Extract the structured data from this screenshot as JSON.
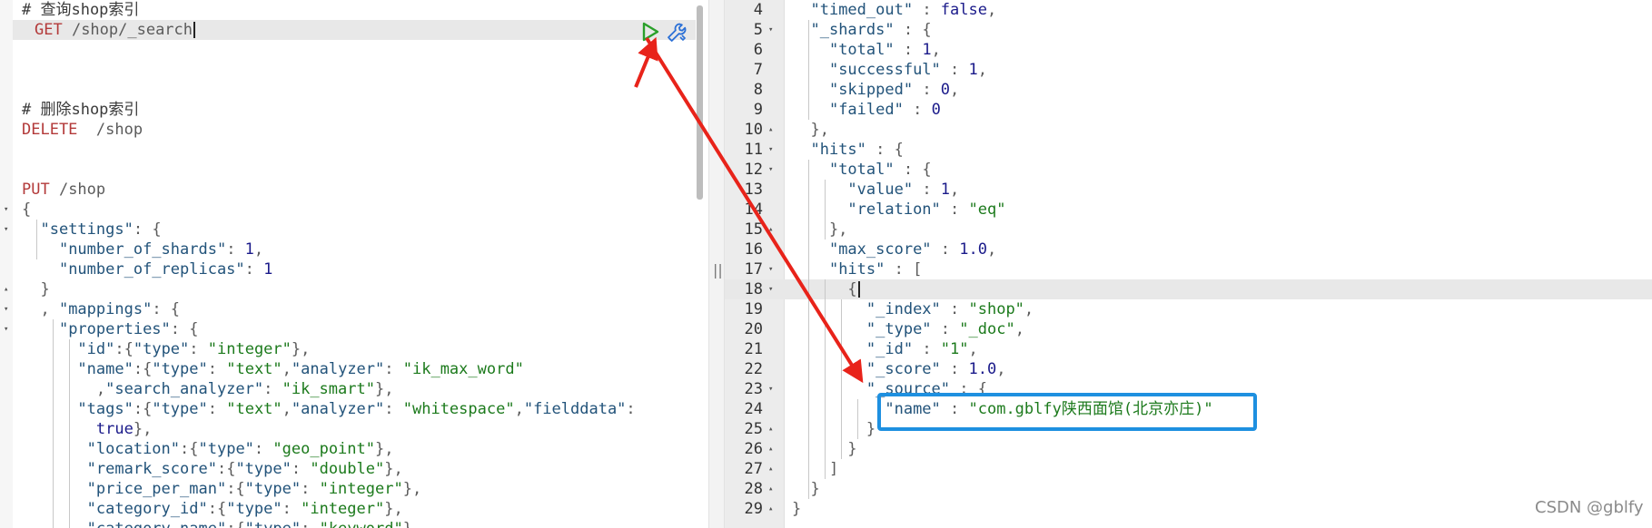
{
  "left_editor": {
    "lines": [
      {
        "tokens": [
          {
            "t": "# 查询shop索引",
            "c": "cmt"
          }
        ]
      },
      {
        "tokens": [
          {
            "t": "GET ",
            "c": "kw"
          },
          {
            "t": "/shop/_search",
            "c": "cm"
          }
        ],
        "caret": true,
        "highlight": true
      },
      {
        "tokens": []
      },
      {
        "tokens": []
      },
      {
        "tokens": []
      },
      {
        "tokens": [
          {
            "t": "# 删除shop索引",
            "c": "cmt"
          }
        ]
      },
      {
        "tokens": [
          {
            "t": "DELETE  ",
            "c": "kw"
          },
          {
            "t": "/shop",
            "c": "cm"
          }
        ]
      },
      {
        "tokens": []
      },
      {
        "tokens": []
      },
      {
        "tokens": [
          {
            "t": "PUT ",
            "c": "kw"
          },
          {
            "t": "/shop",
            "c": "cm"
          }
        ]
      },
      {
        "tokens": [
          {
            "t": "{",
            "c": "cm"
          }
        ],
        "fold": "▾"
      },
      {
        "tokens": [
          {
            "t": "  ",
            "c": "cm"
          },
          {
            "t": "\"settings\"",
            "c": "key"
          },
          {
            "t": ": {",
            "c": "cm"
          }
        ],
        "fold": "▾"
      },
      {
        "tokens": [
          {
            "t": "    ",
            "c": "cm"
          },
          {
            "t": "\"number_of_shards\"",
            "c": "key"
          },
          {
            "t": ": ",
            "c": "cm"
          },
          {
            "t": "1",
            "c": "num"
          },
          {
            "t": ",",
            "c": "cm"
          }
        ]
      },
      {
        "tokens": [
          {
            "t": "    ",
            "c": "cm"
          },
          {
            "t": "\"number_of_replicas\"",
            "c": "key"
          },
          {
            "t": ": ",
            "c": "cm"
          },
          {
            "t": "1",
            "c": "num"
          }
        ]
      },
      {
        "tokens": [
          {
            "t": "  }",
            "c": "cm"
          }
        ],
        "fold": "▴"
      },
      {
        "tokens": [
          {
            "t": "  , ",
            "c": "cm"
          },
          {
            "t": "\"mappings\"",
            "c": "key"
          },
          {
            "t": ": {",
            "c": "cm"
          }
        ],
        "fold": "▾"
      },
      {
        "tokens": [
          {
            "t": "    ",
            "c": "cm"
          },
          {
            "t": "\"properties\"",
            "c": "key"
          },
          {
            "t": ": {",
            "c": "cm"
          }
        ],
        "fold": "▾"
      },
      {
        "tokens": [
          {
            "t": "      ",
            "c": "cm"
          },
          {
            "t": "\"id\"",
            "c": "key"
          },
          {
            "t": ":{",
            "c": "cm"
          },
          {
            "t": "\"type\"",
            "c": "key"
          },
          {
            "t": ": ",
            "c": "cm"
          },
          {
            "t": "\"integer\"",
            "c": "str"
          },
          {
            "t": "},",
            "c": "cm"
          }
        ]
      },
      {
        "tokens": [
          {
            "t": "      ",
            "c": "cm"
          },
          {
            "t": "\"name\"",
            "c": "key"
          },
          {
            "t": ":{",
            "c": "cm"
          },
          {
            "t": "\"type\"",
            "c": "key"
          },
          {
            "t": ": ",
            "c": "cm"
          },
          {
            "t": "\"text\"",
            "c": "str"
          },
          {
            "t": ",",
            "c": "cm"
          },
          {
            "t": "\"analyzer\"",
            "c": "key"
          },
          {
            "t": ": ",
            "c": "cm"
          },
          {
            "t": "\"ik_max_word\"",
            "c": "str"
          }
        ]
      },
      {
        "tokens": [
          {
            "t": "        ,",
            "c": "cm"
          },
          {
            "t": "\"search_analyzer\"",
            "c": "key"
          },
          {
            "t": ": ",
            "c": "cm"
          },
          {
            "t": "\"ik_smart\"",
            "c": "str"
          },
          {
            "t": "},",
            "c": "cm"
          }
        ]
      },
      {
        "tokens": [
          {
            "t": "      ",
            "c": "cm"
          },
          {
            "t": "\"tags\"",
            "c": "key"
          },
          {
            "t": ":{",
            "c": "cm"
          },
          {
            "t": "\"type\"",
            "c": "key"
          },
          {
            "t": ": ",
            "c": "cm"
          },
          {
            "t": "\"text\"",
            "c": "str"
          },
          {
            "t": ",",
            "c": "cm"
          },
          {
            "t": "\"analyzer\"",
            "c": "key"
          },
          {
            "t": ": ",
            "c": "cm"
          },
          {
            "t": "\"whitespace\"",
            "c": "str"
          },
          {
            "t": ",",
            "c": "cm"
          },
          {
            "t": "\"fielddata\"",
            "c": "key"
          },
          {
            "t": ":",
            "c": "cm"
          }
        ]
      },
      {
        "tokens": [
          {
            "t": "        ",
            "c": "cm"
          },
          {
            "t": "true",
            "c": "num"
          },
          {
            "t": "},",
            "c": "cm"
          }
        ]
      },
      {
        "tokens": [
          {
            "t": "       ",
            "c": "cm"
          },
          {
            "t": "\"location\"",
            "c": "key"
          },
          {
            "t": ":{",
            "c": "cm"
          },
          {
            "t": "\"type\"",
            "c": "key"
          },
          {
            "t": ": ",
            "c": "cm"
          },
          {
            "t": "\"geo_point\"",
            "c": "str"
          },
          {
            "t": "},",
            "c": "cm"
          }
        ]
      },
      {
        "tokens": [
          {
            "t": "       ",
            "c": "cm"
          },
          {
            "t": "\"remark_score\"",
            "c": "key"
          },
          {
            "t": ":{",
            "c": "cm"
          },
          {
            "t": "\"type\"",
            "c": "key"
          },
          {
            "t": ": ",
            "c": "cm"
          },
          {
            "t": "\"double\"",
            "c": "str"
          },
          {
            "t": "},",
            "c": "cm"
          }
        ]
      },
      {
        "tokens": [
          {
            "t": "       ",
            "c": "cm"
          },
          {
            "t": "\"price_per_man\"",
            "c": "key"
          },
          {
            "t": ":{",
            "c": "cm"
          },
          {
            "t": "\"type\"",
            "c": "key"
          },
          {
            "t": ": ",
            "c": "cm"
          },
          {
            "t": "\"integer\"",
            "c": "str"
          },
          {
            "t": "},",
            "c": "cm"
          }
        ]
      },
      {
        "tokens": [
          {
            "t": "       ",
            "c": "cm"
          },
          {
            "t": "\"category_id\"",
            "c": "key"
          },
          {
            "t": ":{",
            "c": "cm"
          },
          {
            "t": "\"type\"",
            "c": "key"
          },
          {
            "t": ": ",
            "c": "cm"
          },
          {
            "t": "\"integer\"",
            "c": "str"
          },
          {
            "t": "},",
            "c": "cm"
          }
        ]
      },
      {
        "tokens": [
          {
            "t": "       ",
            "c": "cm"
          },
          {
            "t": "\"category_name\"",
            "c": "key"
          },
          {
            "t": ":{",
            "c": "cm"
          },
          {
            "t": "\"type\"",
            "c": "key"
          },
          {
            "t": ": ",
            "c": "cm"
          },
          {
            "t": "\"keyword\"",
            "c": "str"
          },
          {
            "t": "},",
            "c": "cm"
          }
        ]
      }
    ]
  },
  "right_editor": {
    "lines": [
      {
        "n": "4",
        "fold": "",
        "tokens": [
          {
            "t": "  ",
            "c": "cm"
          },
          {
            "t": "\"timed_out\"",
            "c": "key"
          },
          {
            "t": " : ",
            "c": "cm"
          },
          {
            "t": "false",
            "c": "num"
          },
          {
            "t": ",",
            "c": "cm"
          }
        ]
      },
      {
        "n": "5",
        "fold": "▾",
        "tokens": [
          {
            "t": "  ",
            "c": "cm"
          },
          {
            "t": "\"_shards\"",
            "c": "key"
          },
          {
            "t": " : {",
            "c": "cm"
          }
        ]
      },
      {
        "n": "6",
        "fold": "",
        "tokens": [
          {
            "t": "    ",
            "c": "cm"
          },
          {
            "t": "\"total\"",
            "c": "key"
          },
          {
            "t": " : ",
            "c": "cm"
          },
          {
            "t": "1",
            "c": "num"
          },
          {
            "t": ",",
            "c": "cm"
          }
        ]
      },
      {
        "n": "7",
        "fold": "",
        "tokens": [
          {
            "t": "    ",
            "c": "cm"
          },
          {
            "t": "\"successful\"",
            "c": "key"
          },
          {
            "t": " : ",
            "c": "cm"
          },
          {
            "t": "1",
            "c": "num"
          },
          {
            "t": ",",
            "c": "cm"
          }
        ]
      },
      {
        "n": "8",
        "fold": "",
        "tokens": [
          {
            "t": "    ",
            "c": "cm"
          },
          {
            "t": "\"skipped\"",
            "c": "key"
          },
          {
            "t": " : ",
            "c": "cm"
          },
          {
            "t": "0",
            "c": "num"
          },
          {
            "t": ",",
            "c": "cm"
          }
        ]
      },
      {
        "n": "9",
        "fold": "",
        "tokens": [
          {
            "t": "    ",
            "c": "cm"
          },
          {
            "t": "\"failed\"",
            "c": "key"
          },
          {
            "t": " : ",
            "c": "cm"
          },
          {
            "t": "0",
            "c": "num"
          }
        ]
      },
      {
        "n": "10",
        "fold": "▴",
        "tokens": [
          {
            "t": "  },",
            "c": "cm"
          }
        ]
      },
      {
        "n": "11",
        "fold": "▾",
        "tokens": [
          {
            "t": "  ",
            "c": "cm"
          },
          {
            "t": "\"hits\"",
            "c": "key"
          },
          {
            "t": " : {",
            "c": "cm"
          }
        ]
      },
      {
        "n": "12",
        "fold": "▾",
        "tokens": [
          {
            "t": "    ",
            "c": "cm"
          },
          {
            "t": "\"total\"",
            "c": "key"
          },
          {
            "t": " : {",
            "c": "cm"
          }
        ]
      },
      {
        "n": "13",
        "fold": "",
        "tokens": [
          {
            "t": "      ",
            "c": "cm"
          },
          {
            "t": "\"value\"",
            "c": "key"
          },
          {
            "t": " : ",
            "c": "cm"
          },
          {
            "t": "1",
            "c": "num"
          },
          {
            "t": ",",
            "c": "cm"
          }
        ]
      },
      {
        "n": "14",
        "fold": "",
        "tokens": [
          {
            "t": "      ",
            "c": "cm"
          },
          {
            "t": "\"relation\"",
            "c": "key"
          },
          {
            "t": " : ",
            "c": "cm"
          },
          {
            "t": "\"eq\"",
            "c": "str"
          }
        ]
      },
      {
        "n": "15",
        "fold": "▴",
        "tokens": [
          {
            "t": "    },",
            "c": "cm"
          }
        ]
      },
      {
        "n": "16",
        "fold": "",
        "tokens": [
          {
            "t": "    ",
            "c": "cm"
          },
          {
            "t": "\"max_score\"",
            "c": "key"
          },
          {
            "t": " : ",
            "c": "cm"
          },
          {
            "t": "1.0",
            "c": "num"
          },
          {
            "t": ",",
            "c": "cm"
          }
        ]
      },
      {
        "n": "17",
        "fold": "▾",
        "tokens": [
          {
            "t": "    ",
            "c": "cm"
          },
          {
            "t": "\"hits\"",
            "c": "key"
          },
          {
            "t": " : [",
            "c": "cm"
          }
        ]
      },
      {
        "n": "18",
        "fold": "▾",
        "tokens": [
          {
            "t": "      {",
            "c": "cm"
          }
        ],
        "caret": true,
        "highlight": true
      },
      {
        "n": "19",
        "fold": "",
        "tokens": [
          {
            "t": "        ",
            "c": "cm"
          },
          {
            "t": "\"_index\"",
            "c": "key"
          },
          {
            "t": " : ",
            "c": "cm"
          },
          {
            "t": "\"shop\"",
            "c": "str"
          },
          {
            "t": ",",
            "c": "cm"
          }
        ]
      },
      {
        "n": "20",
        "fold": "",
        "tokens": [
          {
            "t": "        ",
            "c": "cm"
          },
          {
            "t": "\"_type\"",
            "c": "key"
          },
          {
            "t": " : ",
            "c": "cm"
          },
          {
            "t": "\"_doc\"",
            "c": "str"
          },
          {
            "t": ",",
            "c": "cm"
          }
        ]
      },
      {
        "n": "21",
        "fold": "",
        "tokens": [
          {
            "t": "        ",
            "c": "cm"
          },
          {
            "t": "\"_id\"",
            "c": "key"
          },
          {
            "t": " : ",
            "c": "cm"
          },
          {
            "t": "\"1\"",
            "c": "str"
          },
          {
            "t": ",",
            "c": "cm"
          }
        ]
      },
      {
        "n": "22",
        "fold": "",
        "tokens": [
          {
            "t": "        ",
            "c": "cm"
          },
          {
            "t": "\"_score\"",
            "c": "key"
          },
          {
            "t": " : ",
            "c": "cm"
          },
          {
            "t": "1.0",
            "c": "num"
          },
          {
            "t": ",",
            "c": "cm"
          }
        ]
      },
      {
        "n": "23",
        "fold": "▾",
        "tokens": [
          {
            "t": "        ",
            "c": "cm"
          },
          {
            "t": "\"_source\"",
            "c": "key"
          },
          {
            "t": " : {",
            "c": "cm"
          }
        ]
      },
      {
        "n": "24",
        "fold": "",
        "tokens": [
          {
            "t": "          ",
            "c": "cm"
          },
          {
            "t": "\"name\"",
            "c": "key"
          },
          {
            "t": " : ",
            "c": "cm"
          },
          {
            "t": "\"com.gblfy陕西面馆(北京亦庄)\"",
            "c": "str"
          }
        ]
      },
      {
        "n": "25",
        "fold": "▴",
        "tokens": [
          {
            "t": "        }",
            "c": "cm"
          }
        ]
      },
      {
        "n": "26",
        "fold": "▴",
        "tokens": [
          {
            "t": "      }",
            "c": "cm"
          }
        ]
      },
      {
        "n": "27",
        "fold": "▴",
        "tokens": [
          {
            "t": "    ]",
            "c": "cm"
          }
        ]
      },
      {
        "n": "28",
        "fold": "▴",
        "tokens": [
          {
            "t": "  }",
            "c": "cm"
          }
        ]
      },
      {
        "n": "29",
        "fold": "▴",
        "tokens": [
          {
            "t": "}",
            "c": "cm"
          }
        ]
      }
    ]
  },
  "splitter": {
    "grip_label": "||"
  },
  "watermark": "CSDN @gblfy",
  "colors": {
    "highlight_box": "#1e90e0",
    "arrow": "#e8231a",
    "run_icon": "#2aa02a",
    "wrench_icon": "#2a6fd6"
  },
  "icons": {
    "run": "play-icon",
    "settings": "wrench-icon"
  }
}
